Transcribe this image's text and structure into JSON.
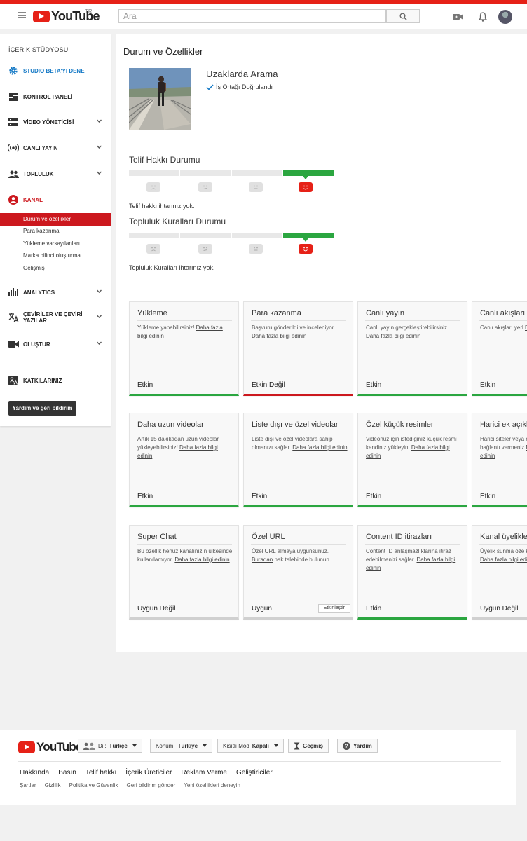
{
  "masthead": {
    "logo_text": "YouTube",
    "country_code": "TR",
    "search_placeholder": "Ara"
  },
  "sidebar": {
    "title": "İÇERİK STÜDYOSU",
    "items": [
      {
        "label": "STUDIO BETA'YI DENE",
        "icon": "gear-icon",
        "color": "#167ac6"
      },
      {
        "label": "KONTROL PANELİ",
        "icon": "dashboard-icon"
      },
      {
        "label": "VİDEO YÖNETİCİSİ",
        "icon": "video-manager-icon"
      },
      {
        "label": "CANLI YAYIN",
        "icon": "live-icon"
      },
      {
        "label": "TOPLULUK",
        "icon": "people-icon"
      },
      {
        "label": "KANAL",
        "icon": "account-icon",
        "color": "#cc181e"
      },
      {
        "label": "ANALYTICS",
        "icon": "analytics-icon"
      },
      {
        "label": "ÇEVİRİLER VE ÇEVİRİ YAZILAR",
        "icon": "translate-icon"
      },
      {
        "label": "OLUŞTUR",
        "icon": "camera-icon"
      },
      {
        "label": "KATKILARINIZ",
        "icon": "translate-icon"
      }
    ],
    "sub_items": [
      "Durum ve özellikler",
      "Para kazanma",
      "Yükleme varsayılanları",
      "Marka bilinci oluşturma",
      "Gelişmiş"
    ],
    "feedback_button": "Yardım ve geri bildirim"
  },
  "main": {
    "page_title": "Durum ve Özellikler",
    "channel_name": "Uzaklarda Arama",
    "verified_label": "İş Ortağı Doğrulandı",
    "copyright": {
      "title": "Telif Hakkı Durumu",
      "level": 4,
      "status": "Telif hakkı ihtarınız yok."
    },
    "community": {
      "title": "Topluluk Kuralları Durumu",
      "level": 4,
      "status": "Topluluk Kuralları ihtarınız yok."
    },
    "cards": [
      {
        "title": "Yükleme",
        "body": "Yükleme yapabilirsiniz! ",
        "link": "Daha fazla bilgi edinin",
        "status": "Etkin",
        "state": "green"
      },
      {
        "title": "Para kazanma",
        "body": "Başvuru gönderildi ve inceleniyor. ",
        "link": "Daha fazla bilgi edinin",
        "status": "Etkin Değil",
        "state": "red"
      },
      {
        "title": "Canlı yayın",
        "body": "Canlı yayın gerçekleştirebilirsiniz. ",
        "link": "Daha fazla bilgi edinin",
        "status": "Etkin",
        "state": "green"
      },
      {
        "title": "Canlı akışları yay",
        "body": "Canlı akışları yerl ",
        "link": "Daha fazla bilgi e",
        "status": "Etkin",
        "state": "green"
      },
      {
        "title": "Daha uzun videolar",
        "body": "Artık 15 dakikadan uzun videolar yükleyebilirsiniz! ",
        "link": "Daha fazla bilgi edinin",
        "status": "Etkin",
        "state": "green"
      },
      {
        "title": "Liste dışı ve özel videolar",
        "body": "Liste dışı ve özel videolara sahip olmanızı sağlar. ",
        "link": "Daha fazla bilgi edinin",
        "status": "Etkin",
        "state": "green"
      },
      {
        "title": "Özel küçük resimler",
        "body": "Videonuz için istediğiniz küçük resmi kendiniz yükleyin. ",
        "link": "Daha fazla bilgi edinin",
        "status": "Etkin",
        "state": "green"
      },
      {
        "title": "Harici ek açıklam",
        "body": "Harici siteler veya ortakları için ek a bağlantı vermeniz ",
        "link": "Daha fazla bilgi edinin",
        "status": "Etkin",
        "state": "green"
      },
      {
        "title": "Super Chat",
        "body": "Bu özellik henüz kanalınızın ülkesinde kullanılamıyor. ",
        "link": "Daha fazla bilgi edinin",
        "status": "Uygun Değil",
        "state": "grey"
      },
      {
        "title": "Özel URL",
        "body": "Özel URL almaya uygunsunuz. ",
        "link": "Buradan",
        "body_after": " hak talebinde bulunun.",
        "status": "Uygun",
        "state": "grey",
        "button": "Etkinleştir"
      },
      {
        "title": "Content ID itirazları",
        "body": "Content ID anlaşmazlıklarına itiraz edebilmenizi sağlar. ",
        "link": "Daha fazla bilgi edinin",
        "status": "Etkin",
        "state": "green"
      },
      {
        "title": "Kanal üyelikleri",
        "body": "Üyelik sunma öze kanalınızda kulla ",
        "link": "Daha fazla bilgi edinin",
        "status": "Uygun Değil",
        "state": "grey"
      }
    ]
  },
  "footer": {
    "logo_text": "YouTube",
    "language": {
      "label": "Dil:",
      "value": "Türkçe"
    },
    "location": {
      "label": "Konum:",
      "value": "Türkiye"
    },
    "restricted": {
      "label": "Kısıtlı Mod",
      "value": "Kapalı"
    },
    "history": "Geçmiş",
    "help": "Yardım",
    "links_primary": [
      "Hakkında",
      "Basın",
      "Telif hakkı",
      "İçerik Üreticiler",
      "Reklam Verme",
      "Geliştiriciler"
    ],
    "links_secondary": [
      "Şartlar",
      "Gizlilik",
      "Politika ve Güvenlik",
      "Geri bildirim gönder",
      "Yeni özellikleri deneyin"
    ]
  },
  "colors": {
    "accent_red": "#e62117",
    "active_red": "#cc181e",
    "link_blue": "#167ac6",
    "success_green": "#2ba640"
  }
}
